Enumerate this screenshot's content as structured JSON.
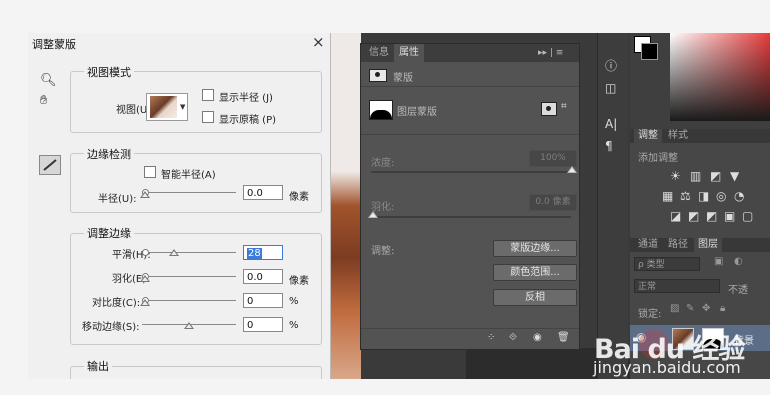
{
  "dialog": {
    "title": "调整蒙版",
    "close": "×",
    "view_mode": {
      "legend": "视图模式",
      "view_label": "视图(U):",
      "show_radius": "显示半径 (J)",
      "show_original": "显示原稿 (P)"
    },
    "edge_detection": {
      "legend": "边缘检测",
      "smart_radius": "智能半径(A)",
      "radius_label": "半径(U):",
      "radius_value": "0.0",
      "radius_unit": "像素"
    },
    "adjust_edge": {
      "legend": "调整边缘",
      "smooth_label": "平滑(H):",
      "smooth_value": "28",
      "smooth_level": 0.3,
      "feather_label": "羽化(E):",
      "feather_value": "0.0",
      "feather_unit": "像素",
      "contrast_label": "对比度(C):",
      "contrast_value": "0",
      "contrast_unit": "%",
      "shift_label": "移动边缘(S):",
      "shift_value": "0",
      "shift_unit": "%",
      "shift_level": 0.5
    },
    "output": {
      "legend": "输出"
    }
  },
  "properties": {
    "tabs": [
      "信息",
      "属性"
    ],
    "menu": "▸▸ | ≡",
    "mask_header": "蒙版",
    "layer_mask_label": "图层蒙版",
    "density_label": "浓度:",
    "density_value": "100%",
    "feather_label": "羽化:",
    "feather_value": "0.0 像素",
    "adjust_label": "调整:",
    "buttons": [
      "蒙版边缘...",
      "颜色范围...",
      "反相"
    ],
    "footer_icons": [
      "⁘",
      "⟐",
      "◉",
      "🗑"
    ]
  },
  "adjustments": {
    "tabs": [
      "调整",
      "样式"
    ],
    "add_label": "添加调整",
    "icons_row1": [
      "☀",
      "▥",
      "◩",
      "▼"
    ],
    "icons_row2": [
      "▦",
      "⚖",
      "◨",
      "◎",
      "◔"
    ],
    "icons_row3": [
      "◪",
      "◩",
      "◩",
      "▣",
      "▢"
    ]
  },
  "layers": {
    "tabs": [
      "通道",
      "路径",
      "图层"
    ],
    "filter_label": "ρ 类型",
    "blend_mode": "正常",
    "opacity_label": "不透",
    "lock_label": "锁定:",
    "layer_name": "背景"
  },
  "tool_strip": {
    "items": [
      "ⓘ",
      "◫",
      "A|",
      "¶"
    ]
  },
  "watermark": {
    "logo": "Bai du 经验",
    "url": "jingyan.baidu.com"
  },
  "colors": {
    "dialog_bg": "#f0f0f0",
    "panel_bg": "#535353",
    "accent": "#3d7bdb",
    "selected_layer": "#5c6e87"
  }
}
